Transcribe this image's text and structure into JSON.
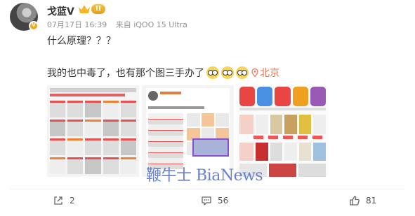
{
  "user": {
    "name": "戈蓝V",
    "vip_level": "II"
  },
  "post": {
    "date": "07月17日 16:39",
    "source": "来自 iQOO 15 Ultra",
    "text_line1": "什么原理？？？",
    "text_line2": "我的也中毒了，也有那个图三手办了",
    "location": "北京"
  },
  "images": {
    "count": 3,
    "watermark": "鞭牛士 BiaNews"
  },
  "actions": {
    "share_count": "2",
    "comment_count": "56",
    "like_count": "81"
  },
  "colors": {
    "accent": "#eb7350",
    "badge": "#f6a623",
    "watermark": "#4664c8"
  }
}
